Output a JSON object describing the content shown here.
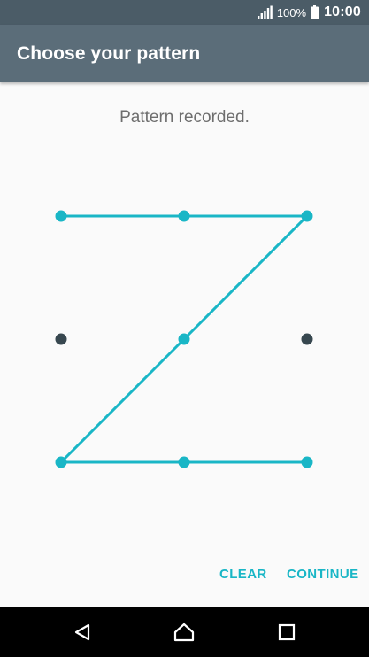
{
  "status_bar": {
    "battery_percent": "100%",
    "time": "10:00",
    "icons": [
      "signal-icon",
      "battery-icon"
    ],
    "background_color": "#4b5c67"
  },
  "app_bar": {
    "title": "Choose your pattern",
    "background_color": "#5b6d79"
  },
  "message": "Pattern recorded.",
  "pattern": {
    "grid_size": 3,
    "dot_color_active": "#19b6c6",
    "dot_color_inactive": "#37474f",
    "line_color": "#19b6c6",
    "recorded_sequence": [
      1,
      2,
      3,
      5,
      7,
      8,
      9
    ],
    "inactive_dots": [
      4,
      6
    ]
  },
  "actions": {
    "clear_label": "CLEAR",
    "continue_label": "CONTINUE",
    "accent_color": "#19b6c6"
  },
  "nav_bar": {
    "icons": [
      "back-icon",
      "home-icon",
      "recents-icon"
    ]
  }
}
